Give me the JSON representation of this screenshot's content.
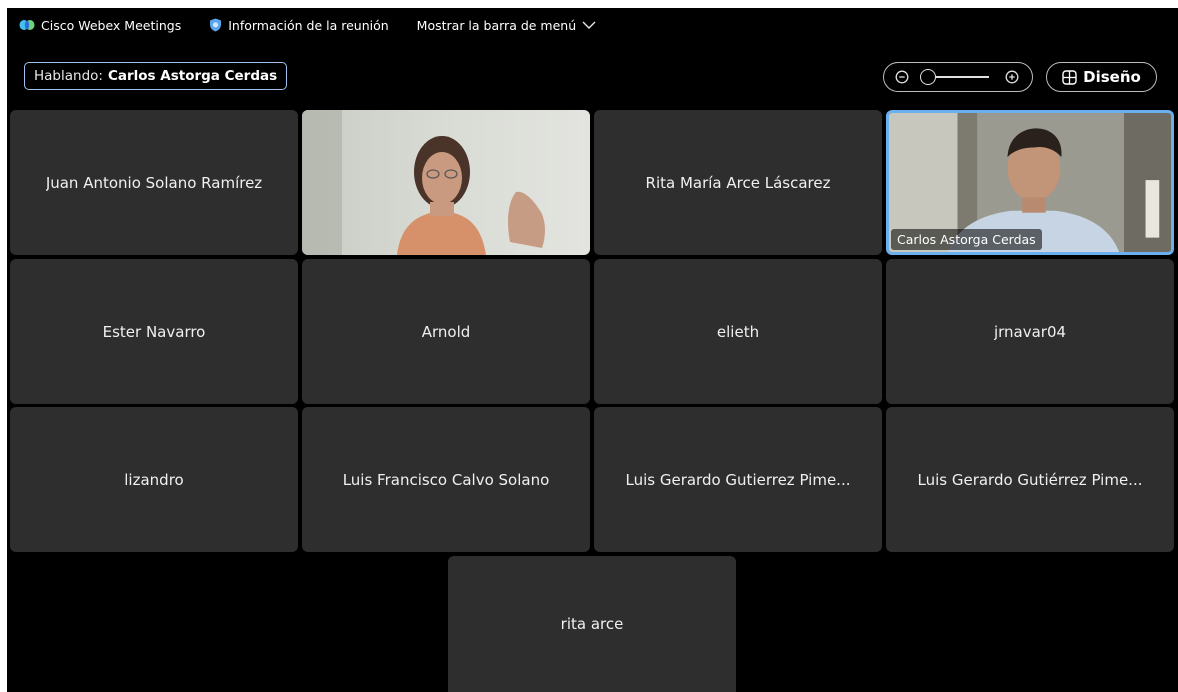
{
  "topbar": {
    "app_name": "Cisco Webex Meetings",
    "meeting_info": "Información de la reunión",
    "menu_toggle": "Mostrar la barra de menú"
  },
  "speaking": {
    "label": "Hablando:",
    "name": "Carlos Astorga Cerdas"
  },
  "layout_button": {
    "label": "Diseño"
  },
  "participants": [
    {
      "name": "Juan Antonio Solano Ramírez"
    },
    {
      "name": "",
      "video": true
    },
    {
      "name": "Rita María Arce Láscarez"
    },
    {
      "name": "Carlos Astorga Cerdas",
      "video": true,
      "active": true
    },
    {
      "name": "Ester Navarro"
    },
    {
      "name": "Arnold"
    },
    {
      "name": "elieth"
    },
    {
      "name": "jrnavar04"
    },
    {
      "name": "lizandro"
    },
    {
      "name": "Luis Francisco Calvo Solano"
    },
    {
      "name": "Luis Gerardo Gutierrez Pime..."
    },
    {
      "name": "Luis Gerardo Gutiérrez Pime..."
    },
    {
      "name": "rita arce"
    }
  ],
  "colors": {
    "tile_bg": "#2e2e2e",
    "active_border": "#6ab0ee",
    "accent": "#1d8cf8"
  }
}
